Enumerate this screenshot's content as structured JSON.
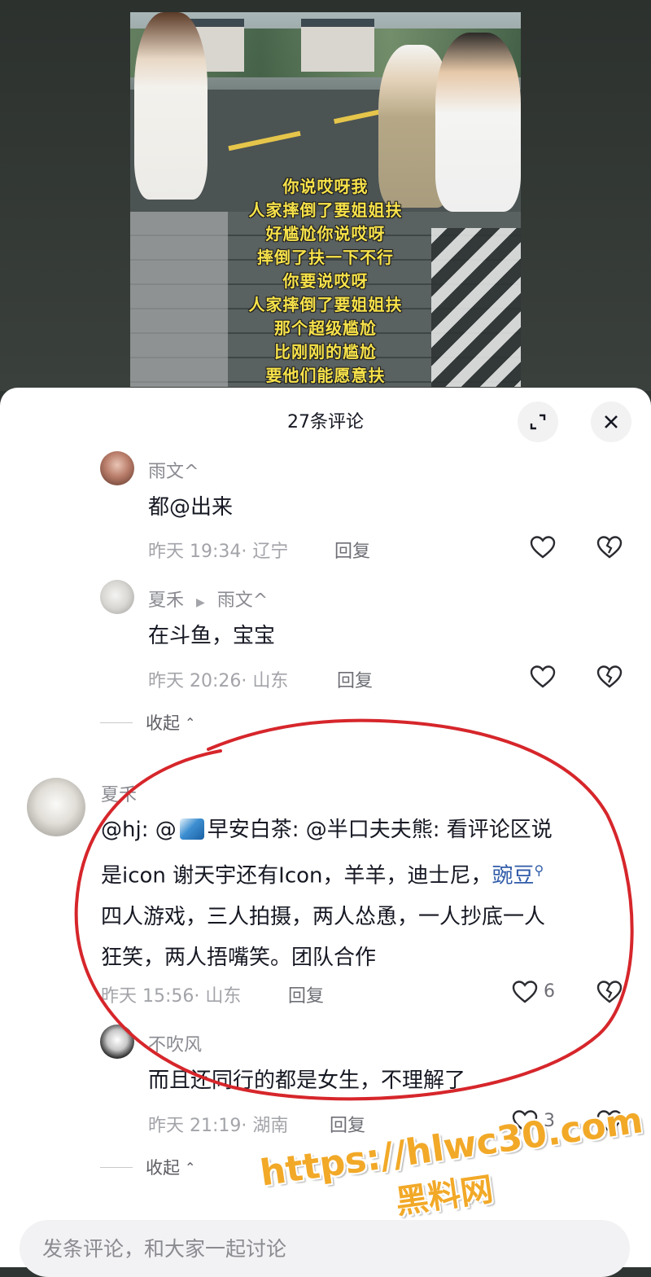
{
  "video": {
    "subtitles": [
      "你说哎呀我",
      "人家摔倒了要姐姐扶",
      "好尴尬你说哎呀",
      "摔倒了扶一下不行",
      "你要说哎呀",
      "人家摔倒了要姐姐扶",
      "那个超级尴尬",
      "比刚刚的尴尬",
      "要他们能愿意扶"
    ]
  },
  "sheet": {
    "title": "27条评论",
    "expand_icon": "expand-icon",
    "close_icon": "close-icon"
  },
  "comments": [
    {
      "name": "雨文^",
      "text": "都@出来",
      "meta": "昨天 19:34· 辽宁",
      "reply": "回复"
    },
    {
      "name": "夏禾",
      "reply_to": "雨文^",
      "text": "在斗鱼，宝宝",
      "meta": "昨天 20:26· 山东",
      "reply": "回复"
    },
    {
      "collapse": "收起"
    },
    {
      "name": "夏禾",
      "text_parts": [
        "@hj: @",
        "早安白茶: @半口夫夫熊: 看评论区说",
        "是icon 谢天宇还有Icon，羊羊，迪士尼，",
        "豌豆",
        "四人游戏，三人拍摄，两人怂恿，一人抄底一人",
        "狂笑，两人捂嘴笑。团队合作"
      ],
      "meta": "昨天 15:56· 山东",
      "reply": "回复",
      "likes": "6"
    },
    {
      "name": "不吹风",
      "text": "而且还同行的都是女生，不理解了",
      "meta": "昨天 21:19· 湖南",
      "reply": "回复",
      "likes": "3"
    },
    {
      "collapse": "收起"
    }
  ],
  "input": {
    "placeholder": "发条评论，和大家一起讨论"
  },
  "watermark": {
    "url": "https://hlwc30.com",
    "name": "黑料网"
  },
  "colors": {
    "accent_link": "#2e5aa8",
    "annotation_red": "#d6262b",
    "watermark": "#f2a928"
  }
}
